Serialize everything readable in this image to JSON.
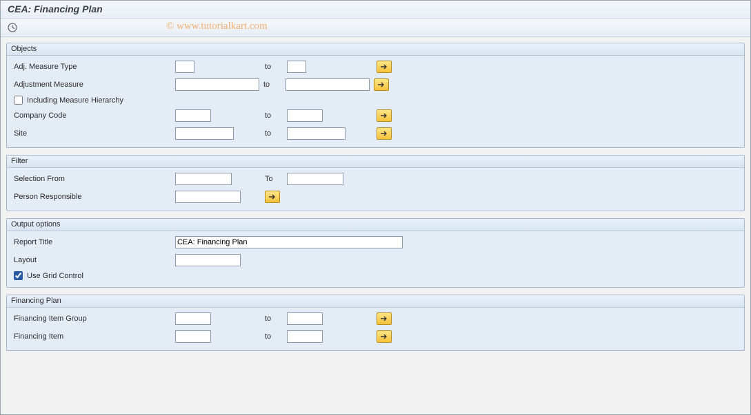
{
  "title": "CEA: Financing Plan",
  "watermark": "© www.tutorialkart.com",
  "groups": {
    "objects": {
      "header": "Objects",
      "adj_measure_type_label": "Adj. Measure Type",
      "adj_measure_type_from": "",
      "adj_measure_type_to": "",
      "adjustment_measure_label": "Adjustment Measure",
      "adjustment_measure_from": "",
      "adjustment_measure_to": "",
      "including_hierarchy_label": "Including Measure Hierarchy",
      "including_hierarchy_checked": false,
      "company_code_label": "Company Code",
      "company_code_from": "",
      "company_code_to": "",
      "site_label": "Site",
      "site_from": "",
      "site_to": "",
      "to_label": "to"
    },
    "filter": {
      "header": "Filter",
      "selection_from_label": "Selection From",
      "selection_from_value": "",
      "selection_to_label": "To",
      "selection_to_value": "",
      "person_responsible_label": "Person Responsible",
      "person_responsible_value": ""
    },
    "output": {
      "header": "Output options",
      "report_title_label": "Report Title",
      "report_title_value": "CEA: Financing Plan",
      "layout_label": "Layout",
      "layout_value": "",
      "use_grid_label": "Use Grid Control",
      "use_grid_checked": true
    },
    "financing_plan": {
      "header": "Financing Plan",
      "item_group_label": "Financing Item Group",
      "item_group_from": "",
      "item_group_to": "",
      "item_label": "Financing Item",
      "item_from": "",
      "item_to": "",
      "to_label": "to"
    }
  }
}
